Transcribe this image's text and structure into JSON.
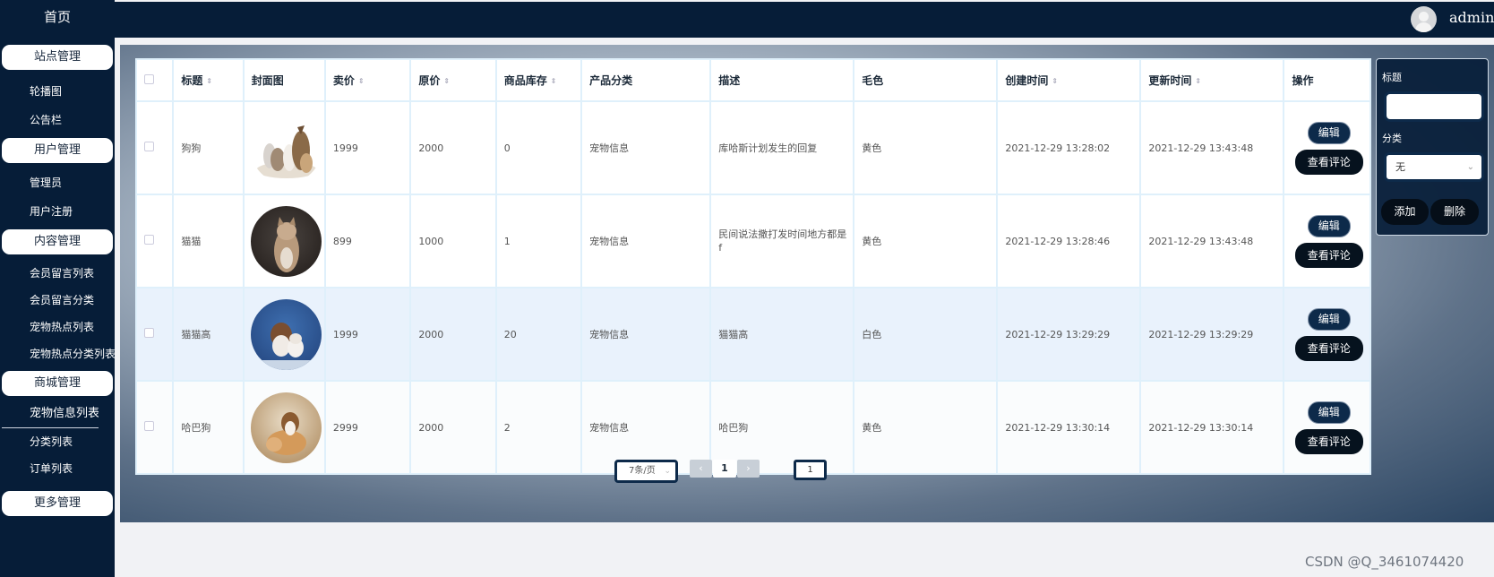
{
  "sidebar": {
    "home": "首页",
    "groups": [
      {
        "title": "站点管理",
        "items": [
          "轮播图",
          "公告栏"
        ]
      },
      {
        "title": "用户管理",
        "items": [
          "管理员",
          "用户注册"
        ]
      },
      {
        "title": "内容管理",
        "items": [
          "会员留言列表",
          "会员留言分类",
          "宠物热点列表",
          "宠物热点分类列表"
        ]
      },
      {
        "title": "商城管理",
        "items": [
          "宠物信息列表",
          "分类列表",
          "订单列表"
        ]
      },
      {
        "title": "更多管理",
        "items": []
      }
    ]
  },
  "topbar": {
    "username": "admin"
  },
  "table": {
    "columns": [
      "标题",
      "封面图",
      "卖价",
      "原价",
      "商品库存",
      "产品分类",
      "描述",
      "毛色",
      "创建时间",
      "更新时间",
      "操作"
    ],
    "rows": [
      {
        "title": "狗狗",
        "price": "1999",
        "original": "2000",
        "stock": "0",
        "category": "宠物信息",
        "desc": "库哈斯计划发生的回复",
        "color": "黄色",
        "created": "2021-12-29 13:28:02",
        "updated": "2021-12-29 13:43:48"
      },
      {
        "title": "猫猫",
        "price": "899",
        "original": "1000",
        "stock": "1",
        "category": "宠物信息",
        "desc": "民间说法撒打发时间地方都是f",
        "color": "黄色",
        "created": "2021-12-29 13:28:46",
        "updated": "2021-12-29 13:43:48"
      },
      {
        "title": "猫猫高",
        "price": "1999",
        "original": "2000",
        "stock": "20",
        "category": "宠物信息",
        "desc": "猫猫高",
        "color": "白色",
        "created": "2021-12-29 13:29:29",
        "updated": "2021-12-29 13:29:29"
      },
      {
        "title": "哈巴狗",
        "price": "2999",
        "original": "2000",
        "stock": "2",
        "category": "宠物信息",
        "desc": "哈巴狗",
        "color": "黄色",
        "created": "2021-12-29 13:30:14",
        "updated": "2021-12-29 13:30:14"
      }
    ],
    "edit_label": "编辑",
    "view_comments_label": "查看评论"
  },
  "search": {
    "title_label": "标题",
    "title_value": "",
    "category_label": "分类",
    "category_selected": "无",
    "add_label": "添加",
    "delete_label": "删除"
  },
  "pagination": {
    "page_size": "7条/页",
    "prev": "‹",
    "current": "1",
    "next": "›",
    "jump_value": "1"
  },
  "watermark": "CSDN @Q_3461074420",
  "icons": {
    "sort": "sort-caret-icon",
    "chevron": "chevron-down-icon",
    "avatar": "user-avatar-icon"
  }
}
